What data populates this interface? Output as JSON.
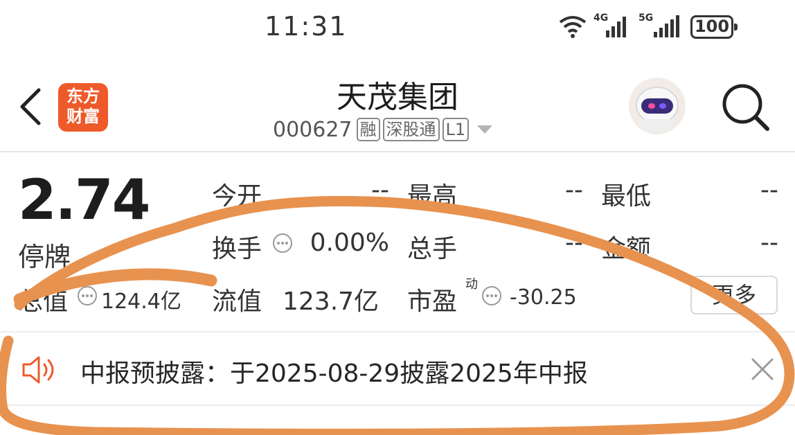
{
  "status_bar": {
    "time": "11:31",
    "wifi_icon": "wifi-icon",
    "network_4g": "4G",
    "network_5g": "5G",
    "battery": "100"
  },
  "header": {
    "back_icon": "chevron-left-icon",
    "logo_line1": "东方",
    "logo_line2": "财富",
    "title": "天茂集团",
    "code": "000627",
    "tags": [
      "融",
      "深股通",
      "L1"
    ],
    "dropdown_icon": "caret-down-icon",
    "avatar_icon": "robot-avatar-icon",
    "search_icon": "search-icon"
  },
  "quote": {
    "price": "2.74",
    "status": "停牌",
    "open_label": "今开",
    "open_value": "--",
    "high_label": "最高",
    "high_value": "--",
    "low_label": "最低",
    "low_value": "--",
    "turnover_label": "换手",
    "turnover_value": "0.00%",
    "volume_label": "总手",
    "volume_value": "--",
    "amount_label": "金额",
    "amount_value": "--",
    "mktcap_label": "总值",
    "mktcap_value": "124.4亿",
    "float_label": "流值",
    "float_value": "123.7亿",
    "pe_label": "市盈",
    "pe_sup": "动",
    "pe_value": "-30.25",
    "more_label": "更多"
  },
  "notice": {
    "icon": "speaker-icon",
    "text": "中报预披露：于2025-08-29披露2025年中报",
    "close_icon": "close-icon"
  },
  "colors": {
    "logo": "#ee5a2a",
    "annotation": "#e8924f"
  }
}
